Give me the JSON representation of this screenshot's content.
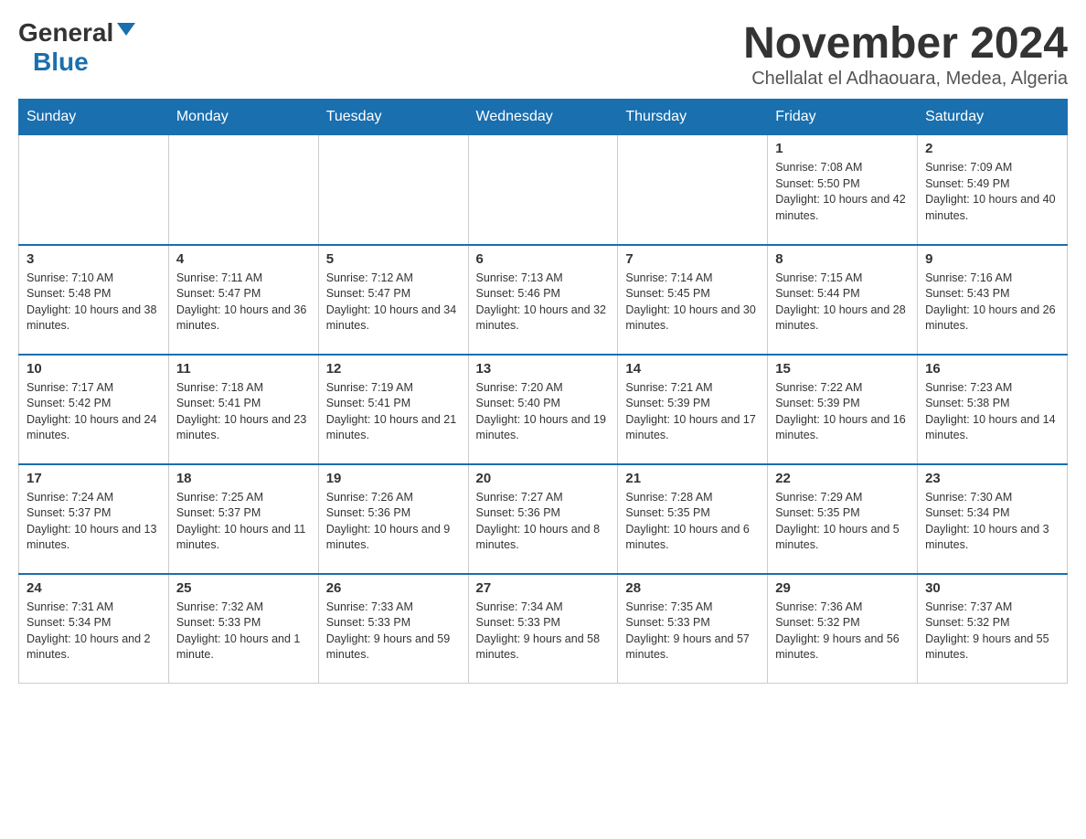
{
  "logo": {
    "general": "General",
    "blue": "Blue"
  },
  "header": {
    "month_year": "November 2024",
    "location": "Chellalat el Adhaouara, Medea, Algeria"
  },
  "days_of_week": [
    "Sunday",
    "Monday",
    "Tuesday",
    "Wednesday",
    "Thursday",
    "Friday",
    "Saturday"
  ],
  "weeks": [
    [
      {
        "day": "",
        "info": ""
      },
      {
        "day": "",
        "info": ""
      },
      {
        "day": "",
        "info": ""
      },
      {
        "day": "",
        "info": ""
      },
      {
        "day": "",
        "info": ""
      },
      {
        "day": "1",
        "info": "Sunrise: 7:08 AM\nSunset: 5:50 PM\nDaylight: 10 hours and 42 minutes."
      },
      {
        "day": "2",
        "info": "Sunrise: 7:09 AM\nSunset: 5:49 PM\nDaylight: 10 hours and 40 minutes."
      }
    ],
    [
      {
        "day": "3",
        "info": "Sunrise: 7:10 AM\nSunset: 5:48 PM\nDaylight: 10 hours and 38 minutes."
      },
      {
        "day": "4",
        "info": "Sunrise: 7:11 AM\nSunset: 5:47 PM\nDaylight: 10 hours and 36 minutes."
      },
      {
        "day": "5",
        "info": "Sunrise: 7:12 AM\nSunset: 5:47 PM\nDaylight: 10 hours and 34 minutes."
      },
      {
        "day": "6",
        "info": "Sunrise: 7:13 AM\nSunset: 5:46 PM\nDaylight: 10 hours and 32 minutes."
      },
      {
        "day": "7",
        "info": "Sunrise: 7:14 AM\nSunset: 5:45 PM\nDaylight: 10 hours and 30 minutes."
      },
      {
        "day": "8",
        "info": "Sunrise: 7:15 AM\nSunset: 5:44 PM\nDaylight: 10 hours and 28 minutes."
      },
      {
        "day": "9",
        "info": "Sunrise: 7:16 AM\nSunset: 5:43 PM\nDaylight: 10 hours and 26 minutes."
      }
    ],
    [
      {
        "day": "10",
        "info": "Sunrise: 7:17 AM\nSunset: 5:42 PM\nDaylight: 10 hours and 24 minutes."
      },
      {
        "day": "11",
        "info": "Sunrise: 7:18 AM\nSunset: 5:41 PM\nDaylight: 10 hours and 23 minutes."
      },
      {
        "day": "12",
        "info": "Sunrise: 7:19 AM\nSunset: 5:41 PM\nDaylight: 10 hours and 21 minutes."
      },
      {
        "day": "13",
        "info": "Sunrise: 7:20 AM\nSunset: 5:40 PM\nDaylight: 10 hours and 19 minutes."
      },
      {
        "day": "14",
        "info": "Sunrise: 7:21 AM\nSunset: 5:39 PM\nDaylight: 10 hours and 17 minutes."
      },
      {
        "day": "15",
        "info": "Sunrise: 7:22 AM\nSunset: 5:39 PM\nDaylight: 10 hours and 16 minutes."
      },
      {
        "day": "16",
        "info": "Sunrise: 7:23 AM\nSunset: 5:38 PM\nDaylight: 10 hours and 14 minutes."
      }
    ],
    [
      {
        "day": "17",
        "info": "Sunrise: 7:24 AM\nSunset: 5:37 PM\nDaylight: 10 hours and 13 minutes."
      },
      {
        "day": "18",
        "info": "Sunrise: 7:25 AM\nSunset: 5:37 PM\nDaylight: 10 hours and 11 minutes."
      },
      {
        "day": "19",
        "info": "Sunrise: 7:26 AM\nSunset: 5:36 PM\nDaylight: 10 hours and 9 minutes."
      },
      {
        "day": "20",
        "info": "Sunrise: 7:27 AM\nSunset: 5:36 PM\nDaylight: 10 hours and 8 minutes."
      },
      {
        "day": "21",
        "info": "Sunrise: 7:28 AM\nSunset: 5:35 PM\nDaylight: 10 hours and 6 minutes."
      },
      {
        "day": "22",
        "info": "Sunrise: 7:29 AM\nSunset: 5:35 PM\nDaylight: 10 hours and 5 minutes."
      },
      {
        "day": "23",
        "info": "Sunrise: 7:30 AM\nSunset: 5:34 PM\nDaylight: 10 hours and 3 minutes."
      }
    ],
    [
      {
        "day": "24",
        "info": "Sunrise: 7:31 AM\nSunset: 5:34 PM\nDaylight: 10 hours and 2 minutes."
      },
      {
        "day": "25",
        "info": "Sunrise: 7:32 AM\nSunset: 5:33 PM\nDaylight: 10 hours and 1 minute."
      },
      {
        "day": "26",
        "info": "Sunrise: 7:33 AM\nSunset: 5:33 PM\nDaylight: 9 hours and 59 minutes."
      },
      {
        "day": "27",
        "info": "Sunrise: 7:34 AM\nSunset: 5:33 PM\nDaylight: 9 hours and 58 minutes."
      },
      {
        "day": "28",
        "info": "Sunrise: 7:35 AM\nSunset: 5:33 PM\nDaylight: 9 hours and 57 minutes."
      },
      {
        "day": "29",
        "info": "Sunrise: 7:36 AM\nSunset: 5:32 PM\nDaylight: 9 hours and 56 minutes."
      },
      {
        "day": "30",
        "info": "Sunrise: 7:37 AM\nSunset: 5:32 PM\nDaylight: 9 hours and 55 minutes."
      }
    ]
  ]
}
